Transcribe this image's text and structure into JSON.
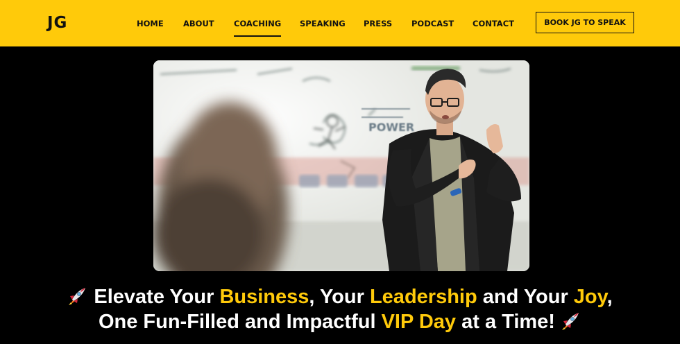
{
  "header": {
    "logo": "JG",
    "nav": [
      {
        "label": "HOME"
      },
      {
        "label": "ABOUT"
      },
      {
        "label": "COACHING",
        "active": true
      },
      {
        "label": "SPEAKING"
      },
      {
        "label": "PRESS"
      },
      {
        "label": "PODCAST"
      },
      {
        "label": "CONTACT"
      }
    ],
    "cta_label": "BOOK JG TO SPEAK"
  },
  "hero": {
    "whiteboard_text": "POWER"
  },
  "headline": {
    "line1": {
      "t1": "Elevate Your ",
      "h1": "Business",
      "t2": ", Your ",
      "h2": "Leadership",
      "t3": " and Your ",
      "h3": "Joy",
      "t4": ","
    },
    "line2": {
      "t1": "One Fun-Filled and Impactful ",
      "h1": "VIP Day",
      "t2": " at a Time!"
    }
  },
  "colors": {
    "brand_yellow": "#ffca0a",
    "background": "#000000",
    "text_dark": "#111111"
  }
}
